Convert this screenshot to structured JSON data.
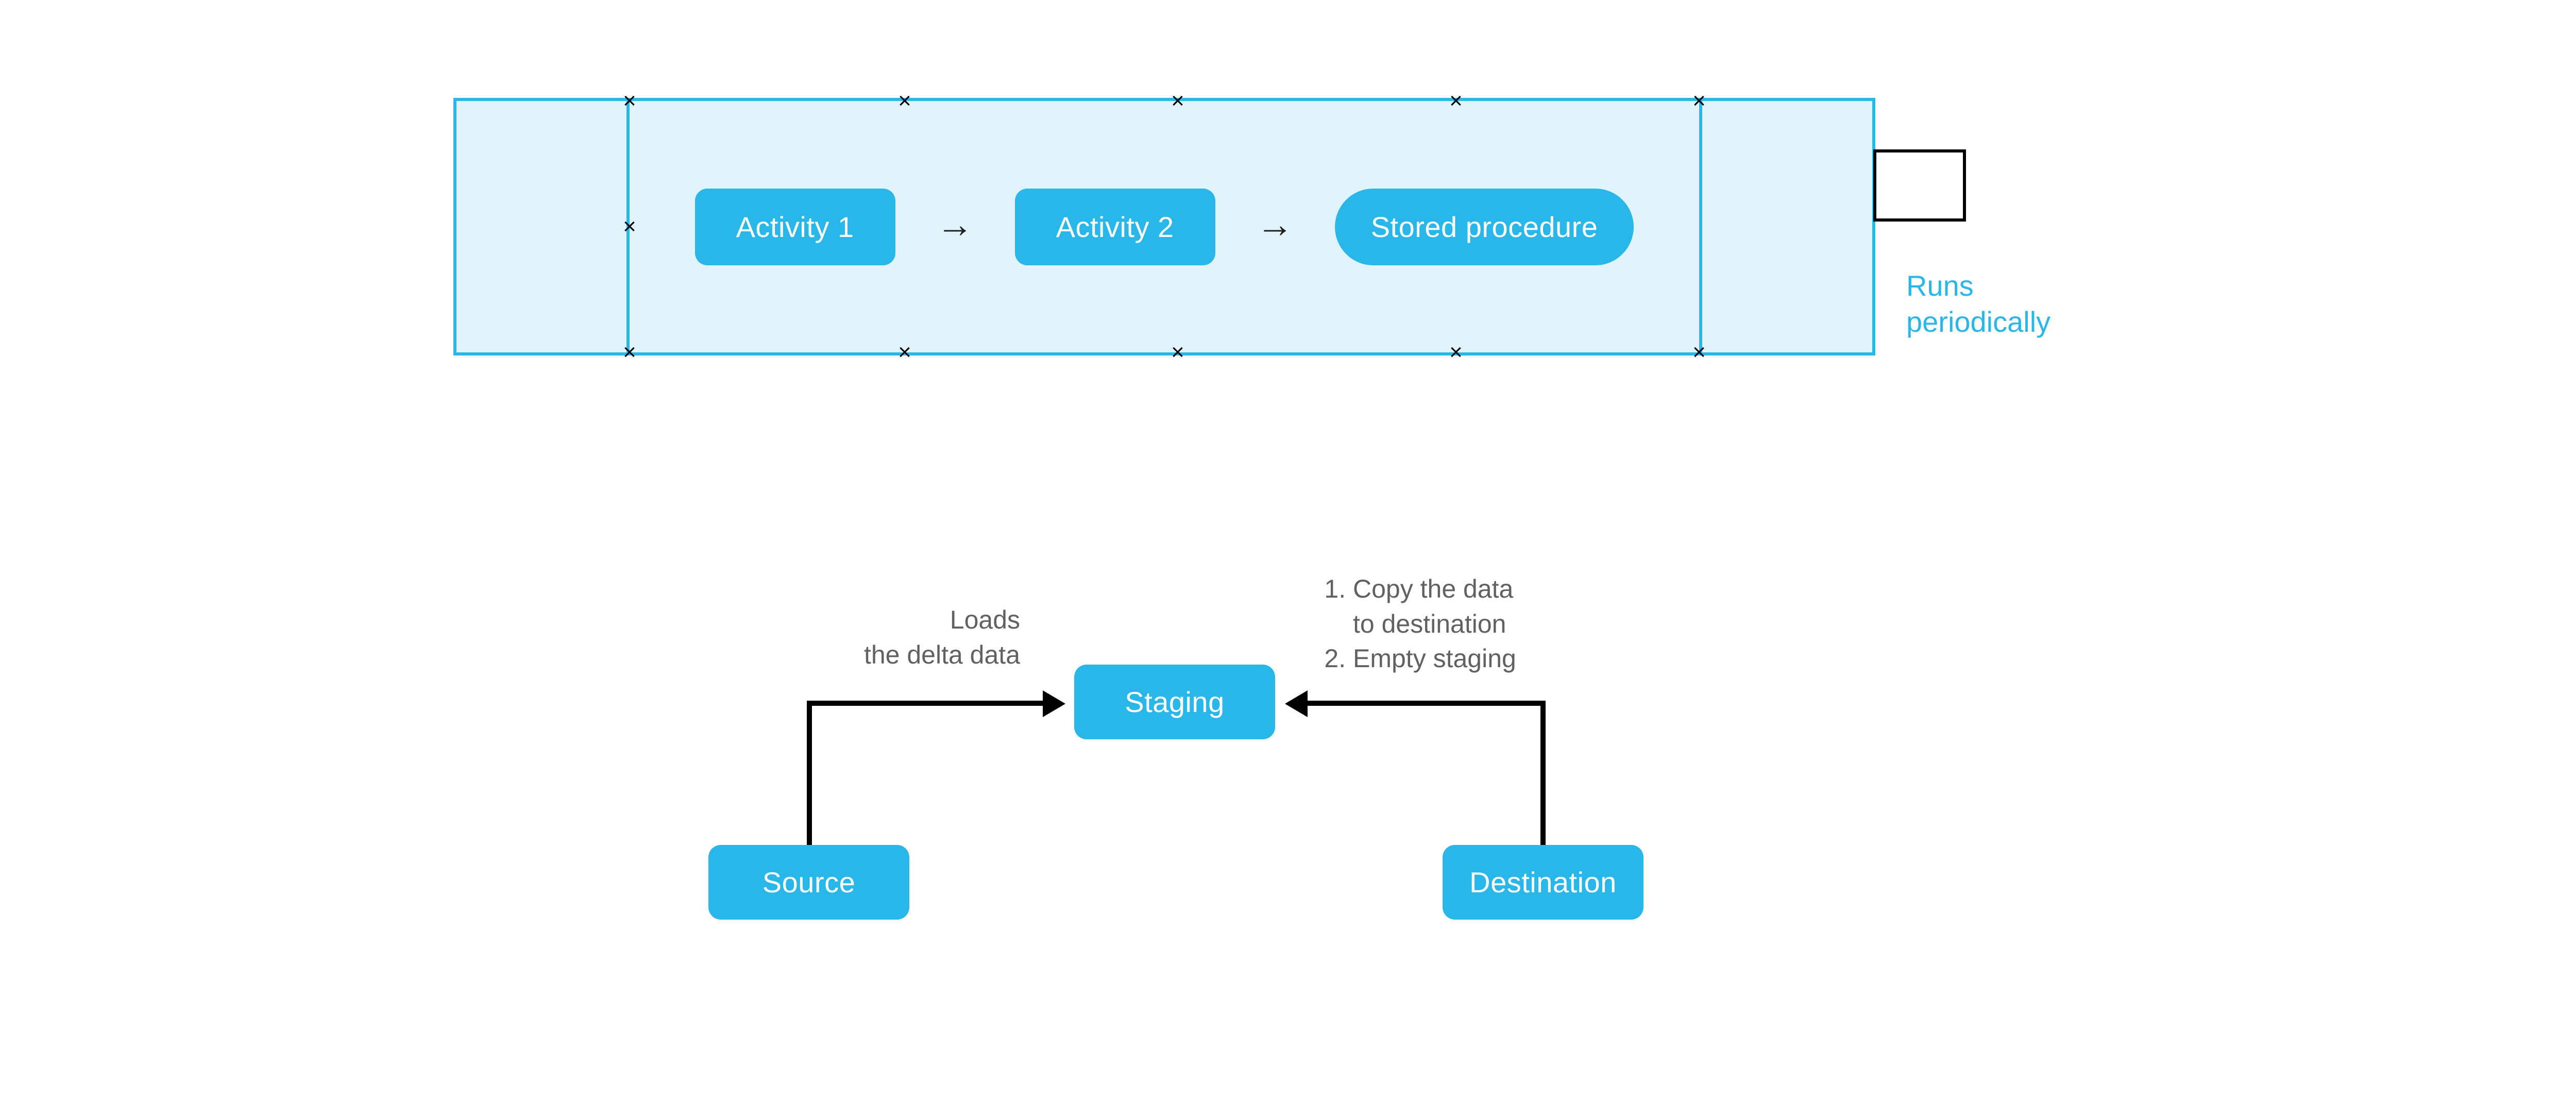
{
  "pipeline": {
    "activity1_label": "Activity 1",
    "activity2_label": "Activity 2",
    "stored_procedure_label": "Stored procedure",
    "runs_label_line1": "Runs",
    "runs_label_line2": "periodically"
  },
  "flow": {
    "source_label": "Source",
    "staging_label": "Staging",
    "destination_label": "Destination",
    "left_arrow_label_line1": "Loads",
    "left_arrow_label_line2": "the delta data",
    "right_list_item1_line1": "Copy the data",
    "right_list_item1_line2": "to destination",
    "right_list_item2": "Empty staging"
  }
}
